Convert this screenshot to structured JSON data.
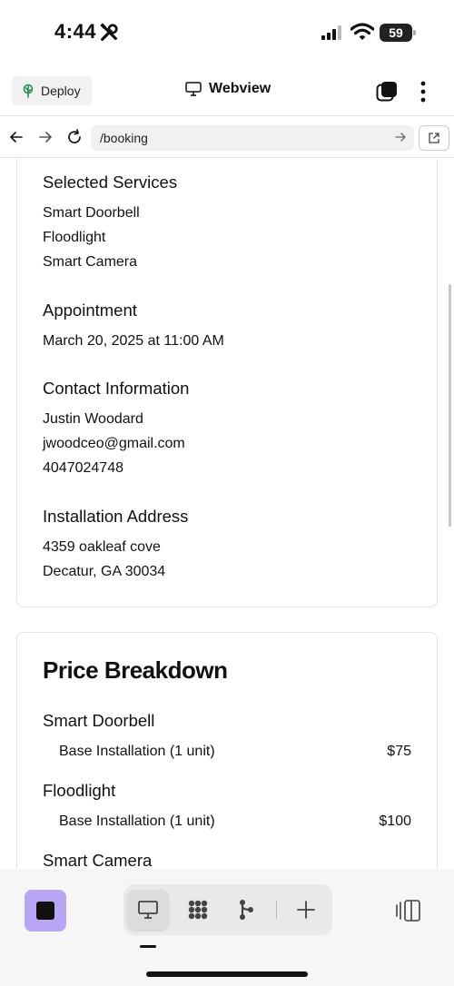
{
  "status_bar": {
    "time": "4:44",
    "battery": "59"
  },
  "header": {
    "deploy_label": "Deploy",
    "title": "Webview"
  },
  "url_bar": {
    "url": "/booking"
  },
  "summary": {
    "selected_services": {
      "heading": "Selected Services",
      "items": [
        "Smart Doorbell",
        "Floodlight",
        "Smart Camera"
      ]
    },
    "appointment": {
      "heading": "Appointment",
      "value": "March 20, 2025 at 11:00 AM"
    },
    "contact": {
      "heading": "Contact Information",
      "name": "Justin Woodard",
      "email": "jwoodceo@gmail.com",
      "phone": "4047024748"
    },
    "address": {
      "heading": "Installation Address",
      "line1": "4359 oakleaf cove",
      "line2": "Decatur, GA 30034"
    }
  },
  "price_breakdown": {
    "title": "Price Breakdown",
    "items": [
      {
        "name": "Smart Doorbell",
        "line": "Base Installation (1 unit)",
        "price": "$75"
      },
      {
        "name": "Floodlight",
        "line": "Base Installation (1 unit)",
        "price": "$100"
      },
      {
        "name": "Smart Camera"
      }
    ]
  },
  "icons": {
    "status": [
      "tools-icon",
      "signal-icon",
      "wifi-icon",
      "battery-icon"
    ],
    "header": [
      "deploy-tree-icon",
      "monitor-icon",
      "tabs-icon",
      "more-vertical-icon"
    ],
    "url": [
      "back-arrow-icon",
      "forward-arrow-icon",
      "reload-icon",
      "go-arrow-icon",
      "open-external-icon"
    ],
    "toolbar": [
      "stop-icon",
      "monitor-icon",
      "dots-grid-icon",
      "branch-icon",
      "plus-icon",
      "panel-toggle-icon"
    ]
  },
  "colors": {
    "stop_button": "#b9a6f4",
    "deploy_icon": "#2e8b57"
  }
}
